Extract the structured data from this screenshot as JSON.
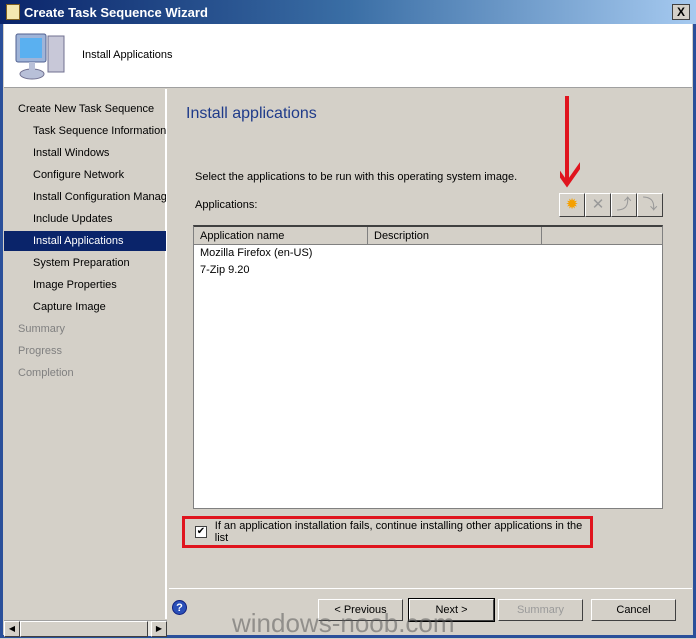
{
  "window": {
    "title": "Create Task Sequence Wizard",
    "close_label": "X"
  },
  "header": {
    "title": "Install Applications"
  },
  "sidebar": {
    "items": [
      {
        "label": "Create New Task Sequence",
        "indent": false,
        "state": "normal"
      },
      {
        "label": "Task Sequence Information",
        "indent": true,
        "state": "normal"
      },
      {
        "label": "Install Windows",
        "indent": true,
        "state": "normal"
      },
      {
        "label": "Configure Network",
        "indent": true,
        "state": "normal"
      },
      {
        "label": "Install Configuration Manager",
        "indent": true,
        "state": "normal"
      },
      {
        "label": "Include Updates",
        "indent": true,
        "state": "normal"
      },
      {
        "label": "Install Applications",
        "indent": true,
        "state": "selected"
      },
      {
        "label": "System Preparation",
        "indent": true,
        "state": "normal"
      },
      {
        "label": "Image Properties",
        "indent": true,
        "state": "normal"
      },
      {
        "label": "Capture Image",
        "indent": true,
        "state": "normal"
      },
      {
        "label": "Summary",
        "indent": false,
        "state": "disabled"
      },
      {
        "label": "Progress",
        "indent": false,
        "state": "disabled"
      },
      {
        "label": "Completion",
        "indent": false,
        "state": "disabled"
      }
    ]
  },
  "main": {
    "title": "Install applications",
    "description": "Select the applications to be run with this operating system image.",
    "applications_label": "Applications:",
    "toolbar": [
      {
        "icon": "new-star-icon",
        "enabled": true
      },
      {
        "icon": "delete-icon",
        "enabled": false
      },
      {
        "icon": "move-up-icon",
        "enabled": false
      },
      {
        "icon": "move-down-icon",
        "enabled": false
      }
    ],
    "columns": [
      "Application name",
      "Description"
    ],
    "rows": [
      {
        "name": "Mozilla Firefox (en-US)",
        "description": ""
      },
      {
        "name": "7-Zip 9.20",
        "description": ""
      }
    ],
    "continue_checkbox": {
      "label": "If an application installation fails, continue installing other applications in the list",
      "checked": true
    }
  },
  "buttons": {
    "previous": "< Previous",
    "next": "Next >",
    "summary": "Summary",
    "cancel": "Cancel"
  },
  "watermark": "windows-noob.com",
  "colors": {
    "annotation": "#e0141e",
    "selected": "#0a246a",
    "title": "#1f3b8a"
  }
}
